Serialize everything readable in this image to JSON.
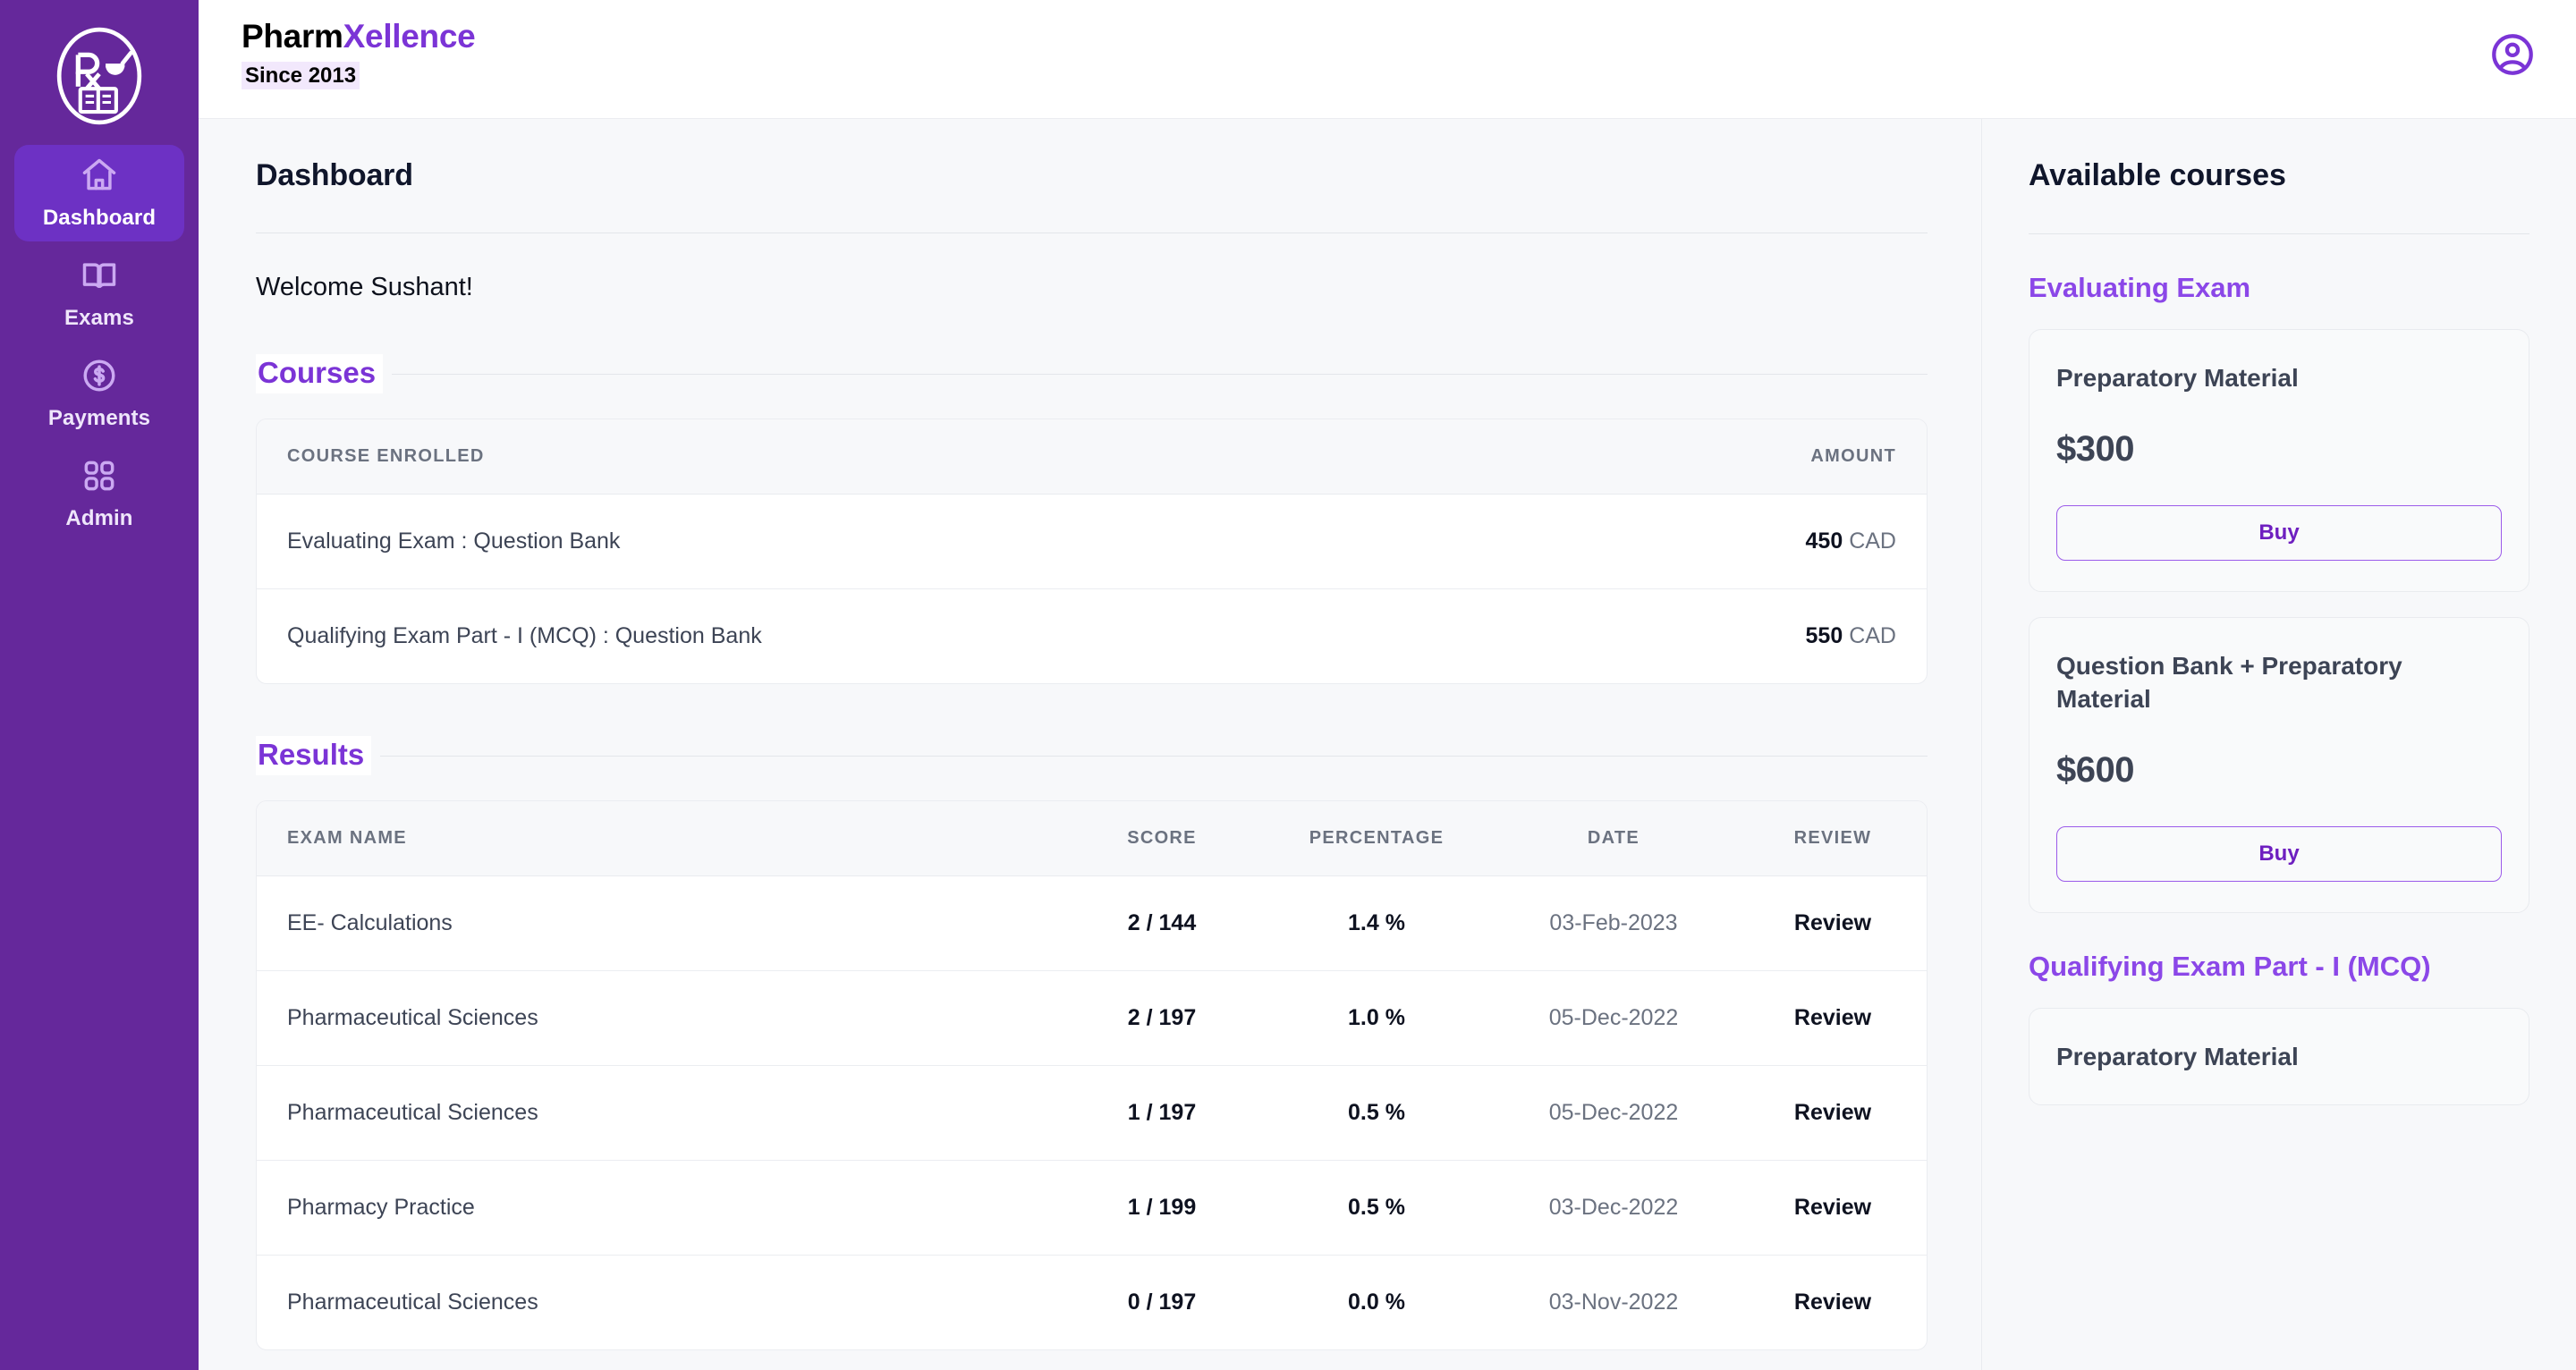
{
  "brand": {
    "title_primary": "Pharm",
    "title_accent": "Xellence",
    "subtitle": "Since 2013",
    "logo_icon": "rx-mortar-book-logo",
    "accent_color": "#7B34D6",
    "sidebar_color": "#65289B"
  },
  "topbar": {
    "avatar_icon": "user-circle-icon"
  },
  "sidebar": {
    "items": [
      {
        "label": "Dashboard",
        "icon": "home-icon",
        "active": true
      },
      {
        "label": "Exams",
        "icon": "book-open-icon",
        "active": false
      },
      {
        "label": "Payments",
        "icon": "dollar-circle-icon",
        "active": false
      },
      {
        "label": "Admin",
        "icon": "grid-squares-icon",
        "active": false
      }
    ]
  },
  "main": {
    "page_title": "Dashboard",
    "welcome": "Welcome Sushant!",
    "courses_section": {
      "title": "Courses",
      "columns": [
        "COURSE ENROLLED",
        "AMOUNT"
      ],
      "rows": [
        {
          "course": "Evaluating Exam : Question Bank",
          "amount": "450",
          "currency": "CAD"
        },
        {
          "course": "Qualifying Exam Part - I (MCQ) : Question Bank",
          "amount": "550",
          "currency": "CAD"
        }
      ]
    },
    "results_section": {
      "title": "Results",
      "columns": [
        "EXAM NAME",
        "SCORE",
        "PERCENTAGE",
        "DATE",
        "REVIEW"
      ],
      "rows": [
        {
          "exam": "EE- Calculations",
          "score": "2 / 144",
          "percentage": "1.4 %",
          "date": "03-Feb-2023",
          "review": "Review"
        },
        {
          "exam": "Pharmaceutical Sciences",
          "score": "2 / 197",
          "percentage": "1.0 %",
          "date": "05-Dec-2022",
          "review": "Review"
        },
        {
          "exam": "Pharmaceutical Sciences",
          "score": "1 / 197",
          "percentage": "0.5 %",
          "date": "05-Dec-2022",
          "review": "Review"
        },
        {
          "exam": "Pharmacy Practice",
          "score": "1 / 199",
          "percentage": "0.5 %",
          "date": "03-Dec-2022",
          "review": "Review"
        },
        {
          "exam": "Pharmaceutical Sciences",
          "score": "0 / 197",
          "percentage": "0.0 %",
          "date": "03-Nov-2022",
          "review": "Review"
        }
      ]
    }
  },
  "right_panel": {
    "title": "Available courses",
    "groups": [
      {
        "name": "Evaluating Exam",
        "products": [
          {
            "name": "Preparatory Material",
            "price": "$300",
            "buy_label": "Buy"
          },
          {
            "name": "Question Bank + Preparatory Material",
            "price": "$600",
            "buy_label": "Buy"
          }
        ]
      },
      {
        "name": "Qualifying Exam Part - I (MCQ)",
        "products": [
          {
            "name": "Preparatory Material"
          }
        ]
      }
    ]
  }
}
